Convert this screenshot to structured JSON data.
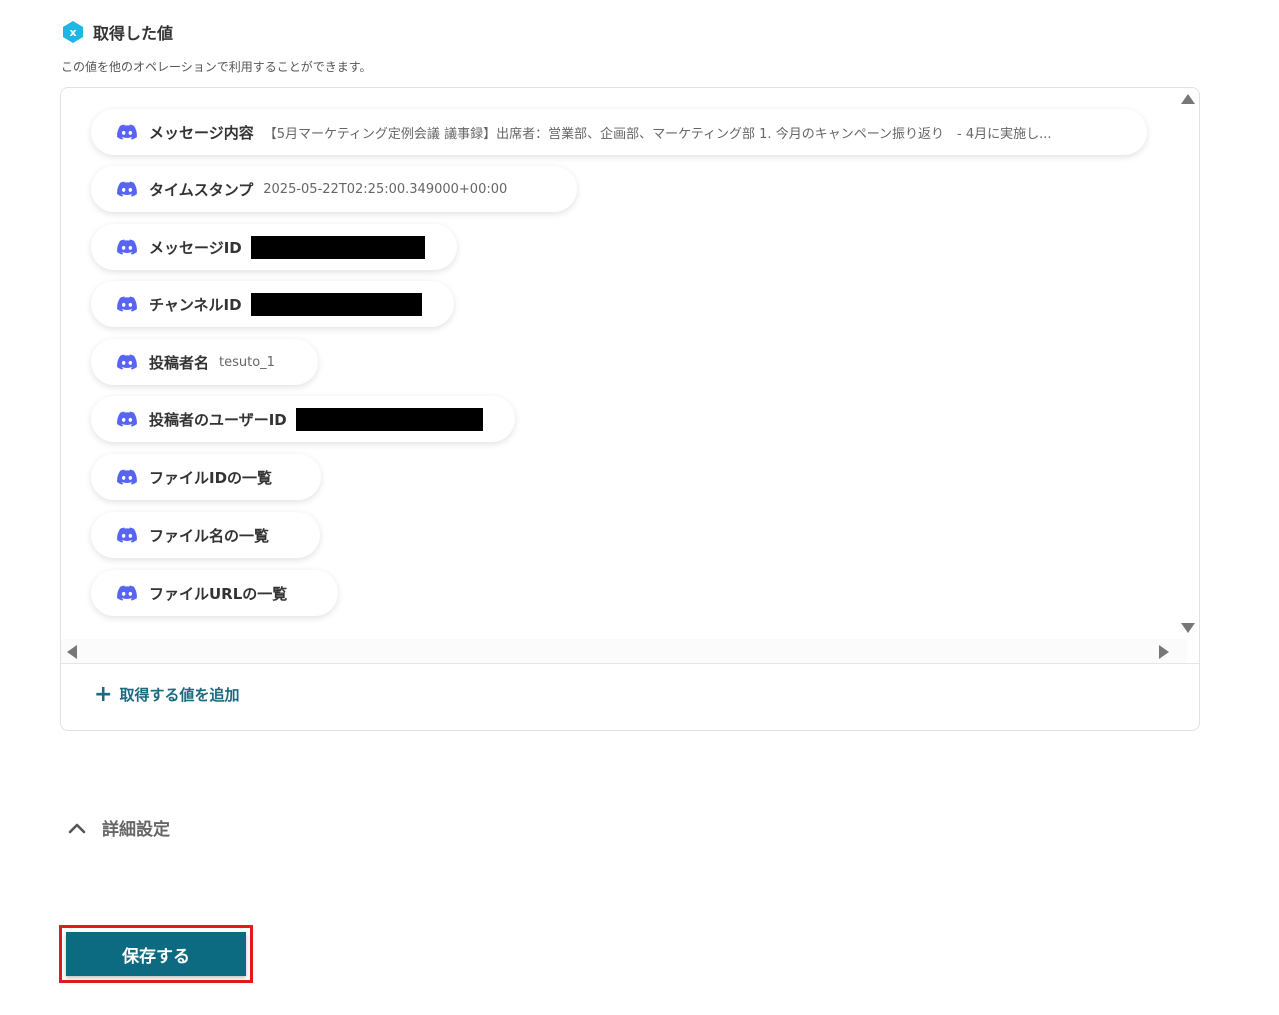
{
  "header": {
    "title": "取得した値",
    "description": "この値を他のオペレーションで利用することができます。"
  },
  "fields": [
    {
      "key": "メッセージ内容",
      "value": "【5月マーケティング定例会議 議事録】出席者：営業部、企画部、マーケティング部 1. 今月のキャンペーン振り返り　- 4月に実施し..."
    },
    {
      "key": "タイムスタンプ",
      "value": "2025-05-22T02:25:00.349000+00:00"
    },
    {
      "key": "メッセージID",
      "value": ""
    },
    {
      "key": "チャンネルID",
      "value": ""
    },
    {
      "key": "投稿者名",
      "value": "tesuto_1"
    },
    {
      "key": "投稿者のユーザーID",
      "value": ""
    },
    {
      "key": "ファイルIDの一覧",
      "value": ""
    },
    {
      "key": "ファイル名の一覧",
      "value": ""
    },
    {
      "key": "ファイルURLの一覧",
      "value": ""
    }
  ],
  "add_value_label": "取得する値を追加",
  "details_label": "詳細設定",
  "save_label": "保存する",
  "colors": {
    "accent": "#1b6a80",
    "save_button": "#0c6a81",
    "highlight": "#e01b1b",
    "discord": "#5865f2",
    "header_icon": "#1fb6e6"
  },
  "icons": {
    "header": "variable-hex-icon",
    "field": "discord-icon",
    "add": "plus-icon",
    "details": "chevron-up-icon"
  }
}
